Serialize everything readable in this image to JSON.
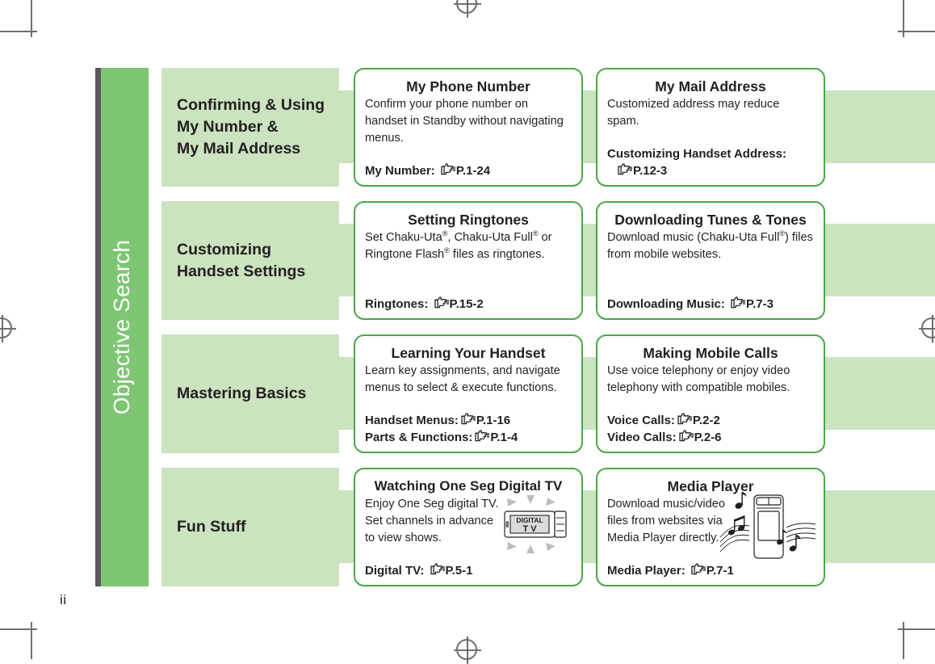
{
  "page": {
    "folio": "ii",
    "sidetab_label": "Objective Search",
    "colors": {
      "sidetab_green": "#7ec674",
      "sidetab_dark_edge": "#58585b",
      "band_light_green": "#cbe3bf",
      "card_border_green": "#4aa849",
      "text": "#231f20",
      "white": "#ffffff"
    }
  },
  "rows": [
    {
      "category": "Confirming & Using\nMy Number &\nMy Mail Address",
      "category_lines": [
        "Confirming & Using",
        "My Number &",
        "My Mail Address"
      ],
      "cards": [
        {
          "title": "My Phone Number",
          "body": "Confirm your phone number on handset in Standby without navigating menus.",
          "refs": [
            {
              "label": "My Number:",
              "icon": "pointing-hand-icon",
              "page": "P.1-24",
              "indent": false
            }
          ],
          "illustration": null
        },
        {
          "title": "My Mail Address",
          "body": "Customized address may reduce spam.",
          "refs": [
            {
              "label": "Customizing Handset Address:",
              "icon": null,
              "page": null,
              "indent": false
            },
            {
              "label": "",
              "icon": "pointing-hand-icon",
              "page": "P.12-3",
              "indent": true
            }
          ],
          "illustration": null
        }
      ]
    },
    {
      "category": "Customizing\nHandset Settings",
      "category_lines": [
        "Customizing",
        "Handset Settings"
      ],
      "cards": [
        {
          "title": "Setting Ringtones",
          "body": "Set Chaku-Uta®, Chaku-Uta Full® or Ringtone Flash® files as ringtones.",
          "refs": [
            {
              "label": "Ringtones:",
              "icon": "pointing-hand-icon",
              "page": "P.15-2",
              "indent": false
            }
          ],
          "illustration": null
        },
        {
          "title": "Downloading Tunes & Tones",
          "body": "Download music (Chaku-Uta Full®) files from mobile websites.",
          "refs": [
            {
              "label": "Downloading Music:",
              "icon": "pointing-hand-icon",
              "page": "P.7-3",
              "indent": false
            }
          ],
          "illustration": null
        }
      ]
    },
    {
      "category": "Mastering Basics",
      "category_lines": [
        "Mastering Basics"
      ],
      "cards": [
        {
          "title": "Learning Your Handset",
          "body": "Learn key assignments, and navigate menus to select & execute functions.",
          "refs": [
            {
              "label": "Handset Menus:",
              "icon": "pointing-hand-icon",
              "page": "P.1-16",
              "indent": false
            },
            {
              "label": "Parts & Functions:",
              "icon": "pointing-hand-icon",
              "page": "P.1-4",
              "indent": false
            }
          ],
          "illustration": null
        },
        {
          "title": "Making Mobile Calls",
          "body": "Use voice telephony or enjoy video telephony with compatible mobiles.",
          "refs": [
            {
              "label": "Voice Calls:",
              "icon": "pointing-hand-icon",
              "page": "P.2-2",
              "indent": false
            },
            {
              "label": "Video Calls:",
              "icon": "pointing-hand-icon",
              "page": "P.2-6",
              "indent": false
            }
          ],
          "illustration": null
        }
      ]
    },
    {
      "category": "Fun Stuff",
      "category_lines": [
        "Fun Stuff"
      ],
      "cards": [
        {
          "title": "Watching One Seg Digital TV",
          "body": "Enjoy One Seg digital TV. Set channels in advance to view shows.",
          "refs": [
            {
              "label": "Digital TV:",
              "icon": "pointing-hand-icon",
              "page": "P.5-1",
              "indent": false
            }
          ],
          "illustration": "digital-tv-handset-illustration",
          "illustration_text": [
            "DIGITAL",
            "T V"
          ]
        },
        {
          "title": "Media Player",
          "body": "Download music/video files from websites via Media Player directly.",
          "refs": [
            {
              "label": "Media Player:",
              "icon": "pointing-hand-icon",
              "page": "P.7-1",
              "indent": false
            }
          ],
          "illustration": "media-player-handset-music-illustration",
          "illustration_text": []
        }
      ]
    }
  ]
}
